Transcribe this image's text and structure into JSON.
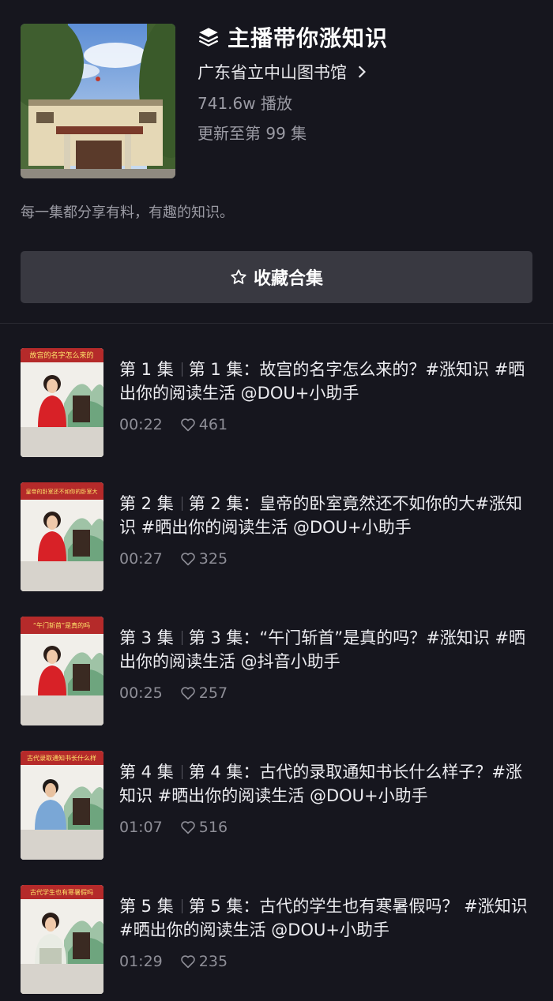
{
  "collection": {
    "title": "主播带你涨知识",
    "author": "广东省立中山图书馆",
    "plays": "741.6w 播放",
    "updated": "更新至第 99 集",
    "description": "每一集都分享有料，有趣的知识。",
    "collect_label": "收藏合集",
    "icons": {
      "title": "stack-layers-icon",
      "author": "chevron-right-icon",
      "collect": "star-outline-icon",
      "likes": "heart-outline-icon"
    }
  },
  "episodes": [
    {
      "number": "第 1 集",
      "title": "第 1 集：故宫的名字怎么来的？#涨知识 #晒出你的阅读生活 @DOU+小助手",
      "duration": "00:22",
      "likes": "461",
      "thumb_caption": "故宫的名字怎么来的"
    },
    {
      "number": "第 2 集",
      "title": "第 2 集：皇帝的卧室竟然还不如你的大#涨知识 #晒出你的阅读生活 @DOU+小助手",
      "duration": "00:27",
      "likes": "325",
      "thumb_caption": "皇帝的卧室还不如你的卧室大"
    },
    {
      "number": "第 3 集",
      "title": "第 3 集：“午门斩首”是真的吗？#涨知识 #晒出你的阅读生活 @抖音小助手",
      "duration": "00:25",
      "likes": "257",
      "thumb_caption": "“午门斩首”是真的吗"
    },
    {
      "number": "第 4 集",
      "title": "第 4 集：古代的录取通知书长什么样子？#涨知识 #晒出你的阅读生活 @DOU+小助手",
      "duration": "01:07",
      "likes": "516",
      "thumb_caption": "古代录取通知书长什么样"
    },
    {
      "number": "第 5 集",
      "title": "第 5 集：古代的学生也有寒暑假吗？ #涨知识 #晒出你的阅读生活 @DOU+小助手",
      "duration": "01:29",
      "likes": "235",
      "thumb_caption": "古代学生也有寒暑假吗"
    }
  ]
}
